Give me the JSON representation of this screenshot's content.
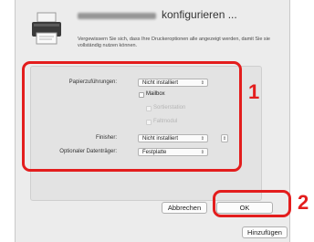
{
  "dialog": {
    "title_suffix": "konfigurieren ...",
    "description": "Vergewissern Sie sich, dass Ihre Druckeroptionen alle angezeigt werden, damit Sie sie vollständig nutzen können."
  },
  "options": {
    "paper_feed": {
      "label": "Papierzuführungen:",
      "value": "Nicht installiert"
    },
    "mailbox": {
      "label": "Mailbox",
      "checked": false
    },
    "option_2": {
      "label": "Sortierstation",
      "enabled": false
    },
    "option_3": {
      "label": "Faltmodul",
      "enabled": false
    },
    "finisher": {
      "label": "Finisher:",
      "value": "Nicht installiert",
      "extra": ""
    },
    "optional_storage": {
      "label": "Optionaler Datenträger:",
      "value": "Festplatte"
    }
  },
  "buttons": {
    "cancel": "Abbrechen",
    "ok": "OK",
    "add": "Hinzufügen"
  },
  "callouts": {
    "step_1": "1",
    "step_2": "2"
  },
  "colors": {
    "callout_red": "#e31d1d",
    "dialog_bg": "#ececec"
  }
}
